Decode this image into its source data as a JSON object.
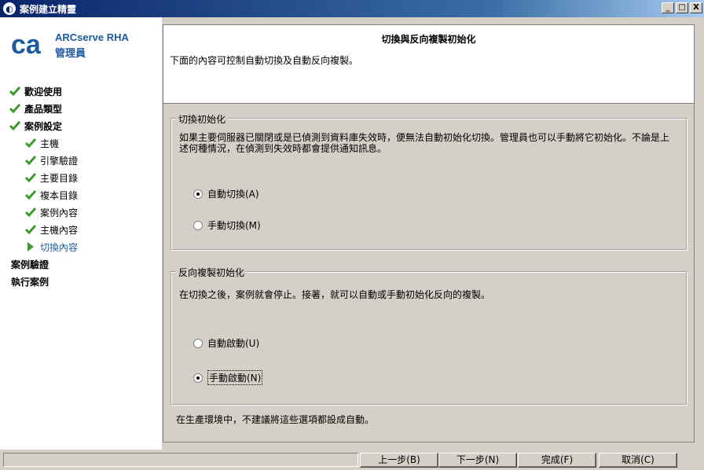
{
  "window": {
    "title": "案例建立精靈",
    "buttons": {
      "minimize": "_",
      "maximize": "□",
      "close": "X"
    }
  },
  "brand": {
    "line1": "ARCserve RHA",
    "line2": "管理員",
    "logo_text": "ca"
  },
  "nav": [
    {
      "label": "歡迎使用",
      "bold": true,
      "icon": "check-icon"
    },
    {
      "label": "產品類型",
      "bold": true,
      "icon": "check-icon"
    },
    {
      "label": "案例設定",
      "bold": true,
      "icon": "check-icon"
    },
    {
      "label": "主機",
      "bold": false,
      "icon": "check-icon"
    },
    {
      "label": "引擎驗證",
      "bold": false,
      "icon": "check-icon"
    },
    {
      "label": "主要目錄",
      "bold": false,
      "icon": "check-icon"
    },
    {
      "label": "複本目錄",
      "bold": false,
      "icon": "check-icon"
    },
    {
      "label": "案例內容",
      "bold": false,
      "icon": "check-icon"
    },
    {
      "label": "主機內容",
      "bold": false,
      "icon": "check-icon"
    },
    {
      "label": "切換內容",
      "bold": false,
      "icon": "arrow-right-icon",
      "active": true
    },
    {
      "label": "案例驗證",
      "bold": true
    },
    {
      "label": "執行案例",
      "bold": true
    }
  ],
  "header": {
    "title": "切換與反向複製初始化",
    "description": "下面的內容可控制自動切換及自動反向複製。"
  },
  "switchover": {
    "title": "切換初始化",
    "description_line1": "如果主要伺服器已關閉或是已偵測到資料庫失效時，便無法自動初始化切換。管理員也可以手動將它初始化。不論是上",
    "description_line2": "述何種情況，在偵測到失效時都會提供通知訊息。",
    "options": [
      {
        "label": "自動切換(A)",
        "selected": true
      },
      {
        "label": "手動切換(M)",
        "selected": false
      }
    ]
  },
  "reverse": {
    "title": "反向複製初始化",
    "description": "在切換之後，案例就會停止。接著，就可以自動或手動初始化反向的複製。",
    "options": [
      {
        "label": "自動啟動(U)",
        "selected": false
      },
      {
        "label": "手動啟動(N)",
        "selected": true
      }
    ]
  },
  "note": "在生產環境中，不建議將這些選項都設成自動。",
  "footer": {
    "back": "上一步(B)",
    "next": "下一步(N)",
    "finish": "完成(F)",
    "cancel": "取消(C)"
  },
  "colors": {
    "accent": "#1e5aa0",
    "check": "#3a9a2a",
    "titlebar": "#0a246a"
  }
}
